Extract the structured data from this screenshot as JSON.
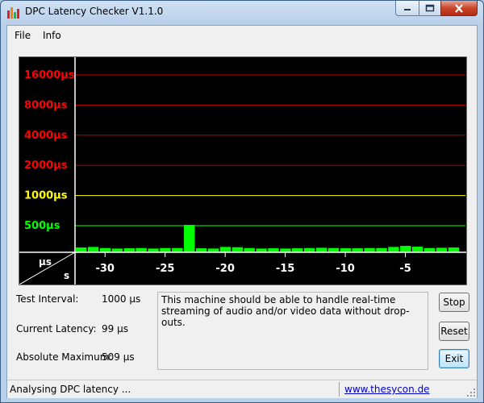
{
  "window": {
    "title": "DPC Latency Checker V1.1.0",
    "icons": {
      "app": "bar-graph-app-icon",
      "minimize": "minimize-icon",
      "maximize": "maximize-icon",
      "close": "close-icon"
    }
  },
  "menu": {
    "file": "File",
    "info": "Info"
  },
  "chart_data": {
    "type": "bar",
    "ylabels": [
      {
        "text": "16000µs",
        "color": "#ff0000"
      },
      {
        "text": "8000µs",
        "color": "#ff0000"
      },
      {
        "text": "4000µs",
        "color": "#ff0000"
      },
      {
        "text": "2000µs",
        "color": "#ff0000"
      },
      {
        "text": "1000µs",
        "color": "#ffff00"
      },
      {
        "text": "500µs",
        "color": "#00ff00"
      }
    ],
    "axis_corner": {
      "y_unit": "µs",
      "x_unit": "s"
    },
    "xticks": [
      "-30",
      "-25",
      "-20",
      "-15",
      "-10",
      "-5"
    ],
    "xtick_values": [
      -30,
      -25,
      -20,
      -15,
      -10,
      -5
    ],
    "x_range": [
      -32.5,
      0
    ],
    "bar_width_s": 1,
    "bar_color": "#00ff00",
    "times": [
      -32,
      -31,
      -30,
      -29,
      -28,
      -27,
      -26,
      -25,
      -24,
      -23,
      -22,
      -21,
      -20,
      -19,
      -18,
      -17,
      -16,
      -15,
      -14,
      -13,
      -12,
      -11,
      -10,
      -9,
      -8,
      -7,
      -6,
      -5,
      -4,
      -3,
      -2,
      -1
    ],
    "values": [
      90,
      100,
      80,
      70,
      75,
      80,
      70,
      80,
      80,
      509,
      75,
      70,
      100,
      95,
      80,
      70,
      75,
      70,
      75,
      80,
      85,
      80,
      75,
      75,
      80,
      80,
      100,
      120,
      105,
      80,
      85,
      90
    ]
  },
  "info": {
    "test_interval_label": "Test Interval:",
    "test_interval_value": "1000 µs",
    "current_latency_label": "Current Latency:",
    "current_latency_value": "99 µs",
    "absolute_maximum_label": "Absolute Maximum:",
    "absolute_maximum_value": "509 µs"
  },
  "message": "This machine should be able to handle real-time streaming of audio and/or video data without drop-outs.",
  "buttons": {
    "stop": "Stop",
    "reset": "Reset",
    "exit": "Exit"
  },
  "status": {
    "text": "Analysing DPC latency ...",
    "link": "www.thesycon.de"
  }
}
